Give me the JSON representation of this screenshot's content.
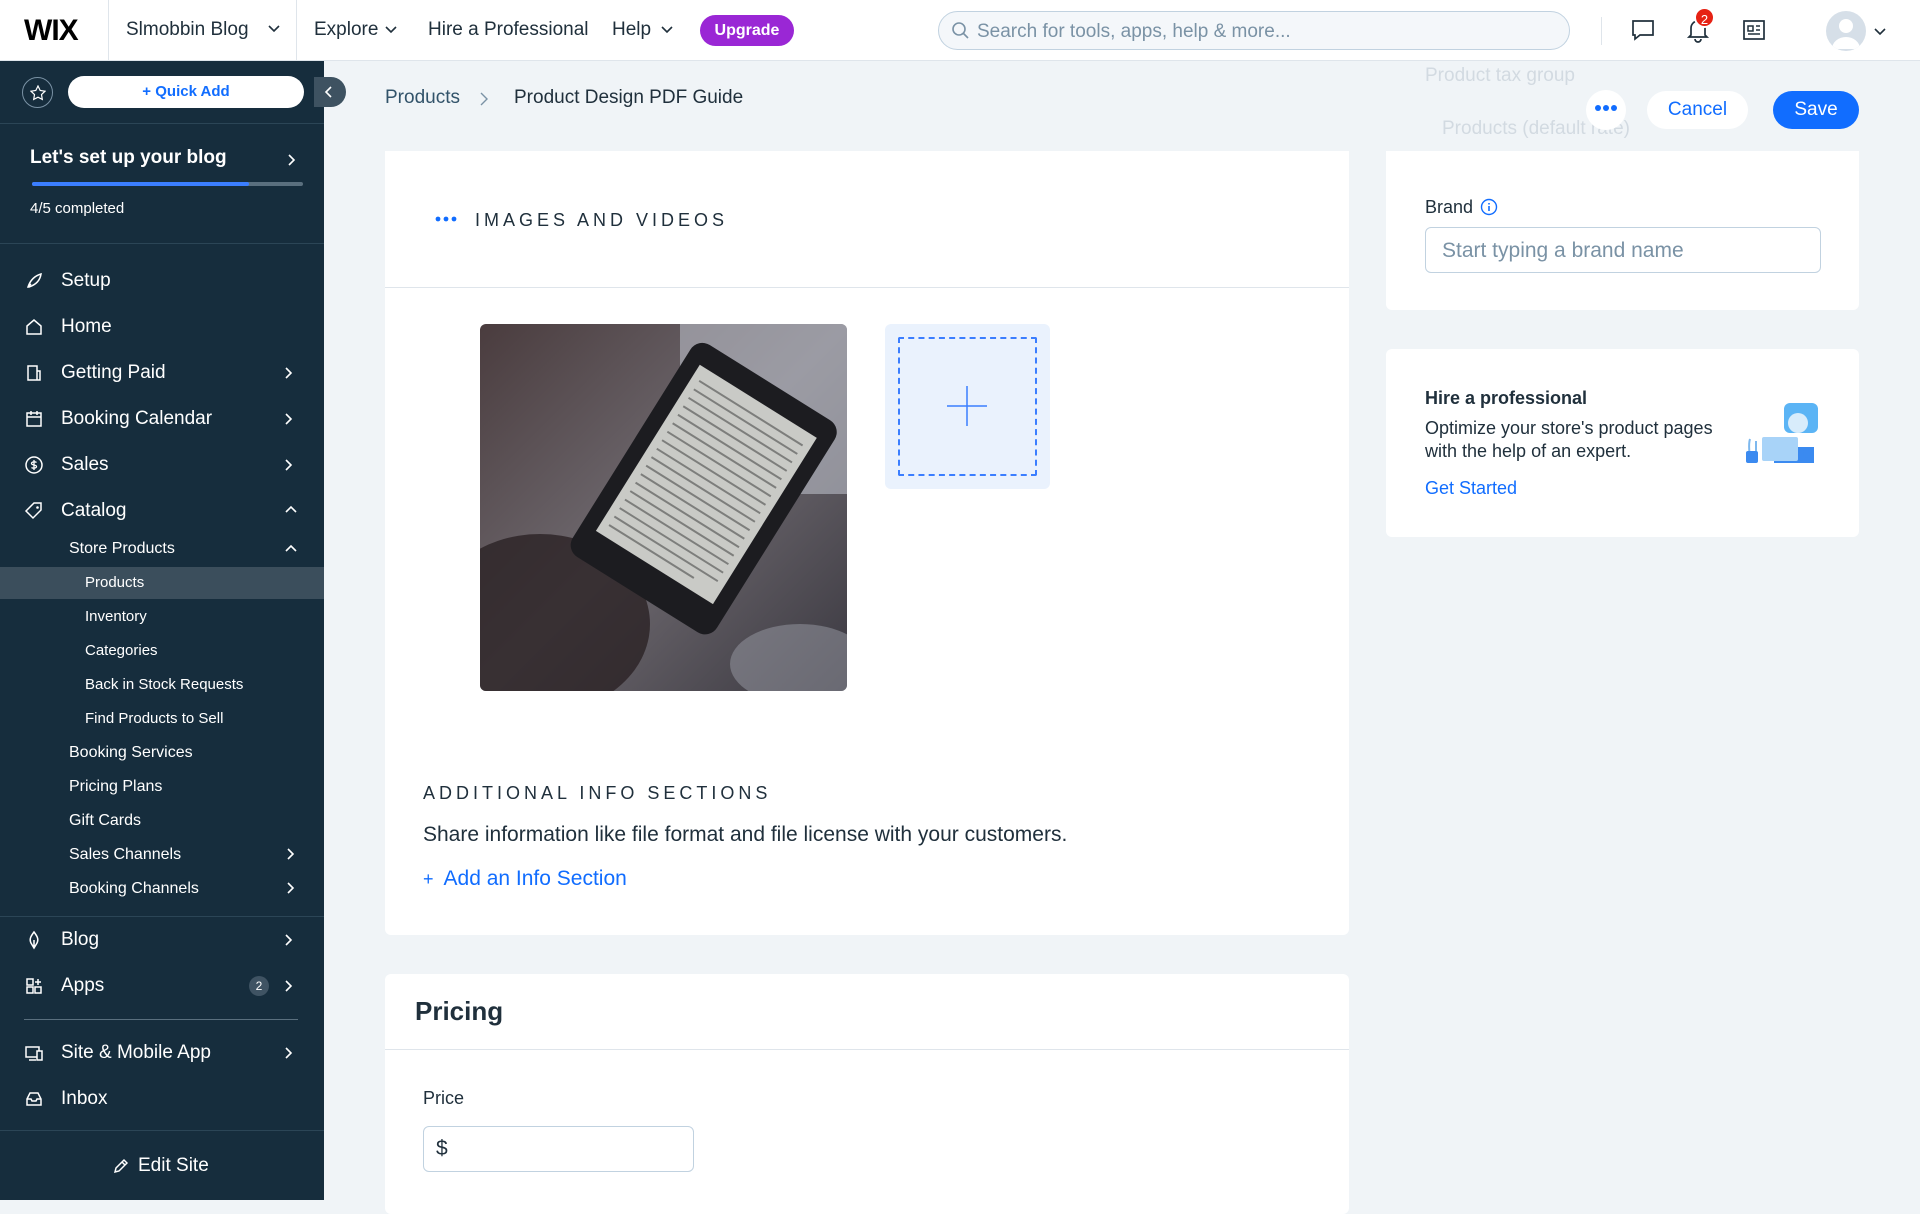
{
  "topbar": {
    "logo": "WIX",
    "site_name": "Slmobbin Blog",
    "nav": [
      "Explore",
      "Hire a Professional",
      "Help"
    ],
    "upgrade": "Upgrade",
    "search_placeholder": "Search for tools, apps, help & more...",
    "notification_count": "2"
  },
  "sidebar": {
    "quick_add": "Quick Add",
    "setup_title": "Let's set up your blog",
    "progress": 0.8,
    "progress_text": "4/5 completed",
    "items": [
      {
        "label": "Setup",
        "icon": "rocket-icon"
      },
      {
        "label": "Home",
        "icon": "home-icon"
      },
      {
        "label": "Getting Paid",
        "icon": "getting-paid-icon"
      },
      {
        "label": "Booking Calendar",
        "icon": "calendar-icon"
      },
      {
        "label": "Sales",
        "icon": "dollar-icon"
      },
      {
        "label": "Catalog",
        "icon": "tag-icon"
      }
    ],
    "catalog_items": [
      "Store Products",
      "Products",
      "Inventory",
      "Categories",
      "Back in Stock Requests",
      "Find Products to Sell",
      "Booking Services",
      "Pricing Plans",
      "Gift Cards",
      "Sales Channels",
      "Booking Channels"
    ],
    "blog": "Blog",
    "apps": "Apps",
    "apps_badge": "2",
    "site_mobile": "Site & Mobile App",
    "inbox": "Inbox",
    "edit_site": "Edit Site"
  },
  "header": {
    "breadcrumb_root": "Products",
    "breadcrumb_current": "Product Design PDF Guide",
    "cancel": "Cancel",
    "save": "Save",
    "ghost_label": "Product tax group",
    "ghost_value": "Products (default rate)"
  },
  "main": {
    "images_title": "IMAGES AND VIDEOS",
    "info_title": "ADDITIONAL INFO SECTIONS",
    "info_desc": "Share information like file format and file license with your customers.",
    "add_info": "Add an Info Section",
    "pricing_title": "Pricing",
    "price_label": "Price",
    "currency": "$"
  },
  "right": {
    "brand_label": "Brand",
    "brand_placeholder": "Start typing a brand name",
    "hire_title": "Hire a professional",
    "hire_desc": "Optimize your store's product pages with the help of an expert.",
    "hire_link": "Get Started"
  },
  "colors": {
    "accent": "#116dff",
    "sidebar": "#162d3d",
    "upgrade": "#9a27d5",
    "badge": "#e62214"
  }
}
